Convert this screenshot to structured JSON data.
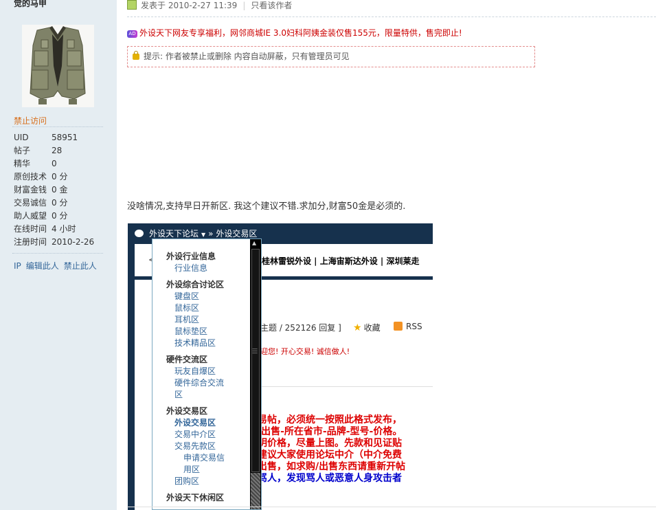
{
  "sidebar": {
    "username": "觉的马甲",
    "ban_label": "禁止访问",
    "stats": [
      {
        "key": "UID",
        "value": "58951"
      },
      {
        "key": "帖子",
        "value": "28"
      },
      {
        "key": "精华",
        "value": "0"
      },
      {
        "key": "原创技术",
        "value": "0 分"
      },
      {
        "key": "财富金钱",
        "value": "0 金"
      },
      {
        "key": "交易诚信",
        "value": "0 分"
      },
      {
        "key": "助人威望",
        "value": "0 分"
      },
      {
        "key": "在线时间",
        "value": "4 小时"
      },
      {
        "key": "注册时间",
        "value": "2010-2-26"
      }
    ],
    "actions": [
      "IP",
      "编辑此人",
      "禁止此人"
    ]
  },
  "post": {
    "posted_at": "发表于 2010-2-27 11:39",
    "only_author": "只看该作者",
    "ad_icon": "AD",
    "ad_text": "外设天下网友专享福利，网邻商城IE 3.0妇科阿姨金装仅售155元，限量特供，售完即止!",
    "notice": "提示: 作者被禁止或删除 内容自动屏蔽，只有管理员可见",
    "body": "没啥情况,支持早日开新区. 我这个建议不错.求加分,财富50金是必须的."
  },
  "screenshot": {
    "nav_forum": "外设天下论坛",
    "nav_crumb": "» 外设交易区",
    "hbar_left": "<",
    "hbar_forums": "桂林雷锐外设 | 上海宙斯达外设 | 深圳莱走",
    "stats": "主题 / 252126 回复 ]",
    "fav": "收藏",
    "rss": "RSS",
    "welcome": "迎您! 开心交易! 诚信做人!",
    "big_lines": [
      {
        "text": "易帖，必须统一按照此格式发布，",
        "color": "red"
      },
      {
        "text": "/出售-所在省市-品牌-型号-价格。",
        "color": "red"
      },
      {
        "text": "明价格，尽量上图。先款和见证贴",
        "color": "red"
      },
      {
        "text": "建议大家使用论坛中介（中介免费",
        "color": "red"
      },
      {
        "text": "出售，如求购/出售东西请重新开帖",
        "color": "red"
      },
      {
        "text": "骂人，发现骂人或恶意人身攻击者",
        "color": "blue"
      }
    ],
    "dropdown": [
      {
        "type": "group",
        "label": "外设行业信息"
      },
      {
        "type": "item",
        "label": "行业信息"
      },
      {
        "type": "group",
        "label": "外设综合讨论区"
      },
      {
        "type": "item",
        "label": "键盘区"
      },
      {
        "type": "item",
        "label": "鼠标区"
      },
      {
        "type": "item",
        "label": "耳机区"
      },
      {
        "type": "item",
        "label": "鼠标垫区"
      },
      {
        "type": "item",
        "label": "技术精品区"
      },
      {
        "type": "group",
        "label": "硬件交流区"
      },
      {
        "type": "item",
        "label": "玩友自爆区"
      },
      {
        "type": "item",
        "label": "硬件综合交流"
      },
      {
        "type": "item",
        "label": "区"
      },
      {
        "type": "group",
        "label": "外设交易区"
      },
      {
        "type": "current",
        "label": "外设交易区"
      },
      {
        "type": "item",
        "label": "交易中介区"
      },
      {
        "type": "item",
        "label": "交易先款区"
      },
      {
        "type": "sub",
        "label": "申请交易信"
      },
      {
        "type": "sub",
        "label": "用区"
      },
      {
        "type": "item",
        "label": "团购区"
      },
      {
        "type": "group",
        "label": "外设天下休闲区"
      }
    ]
  }
}
